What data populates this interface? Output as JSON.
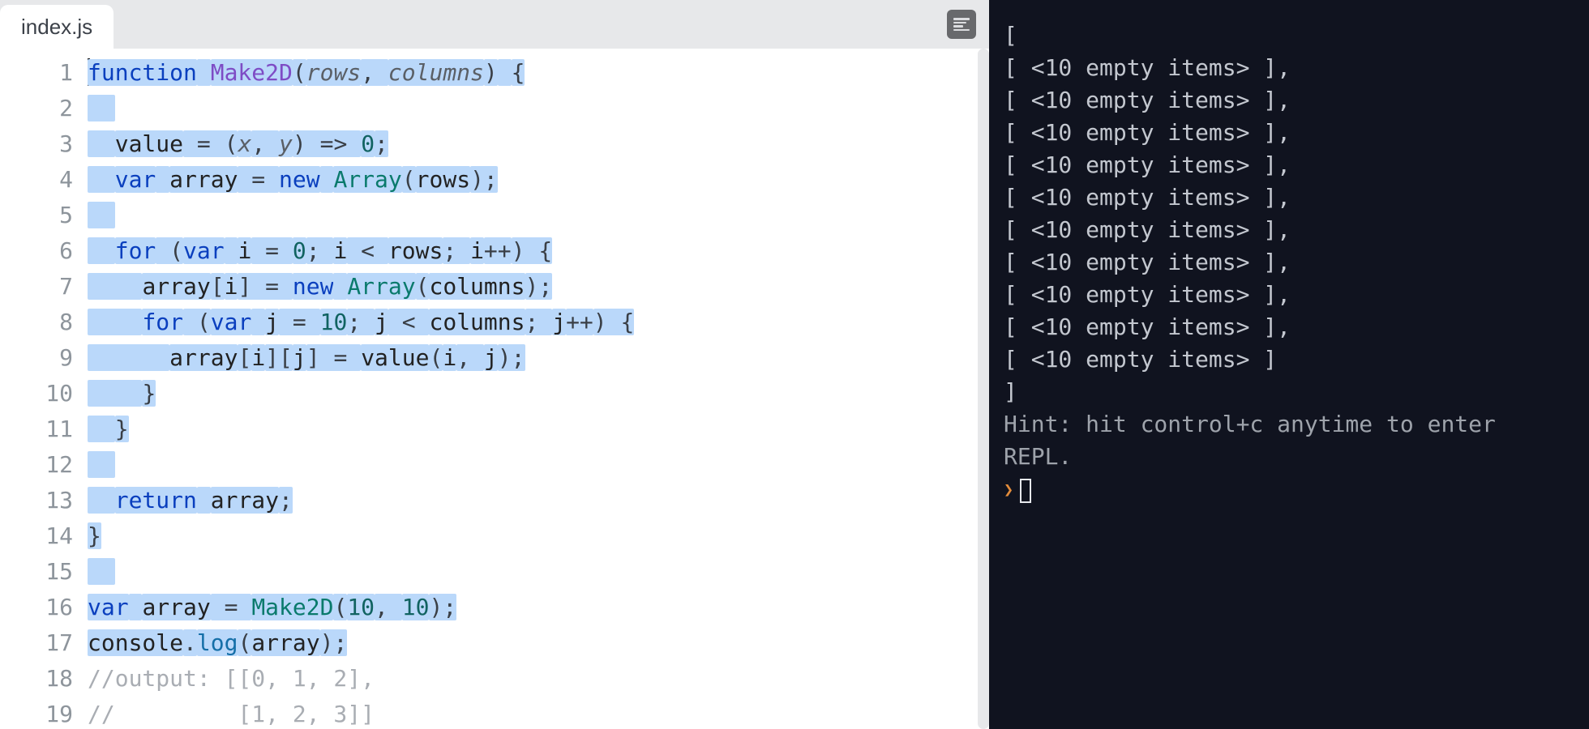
{
  "tabs": {
    "active": "index.js"
  },
  "editor": {
    "line_count": 19,
    "code_tokens": [
      [
        {
          "t": "function",
          "c": "kw",
          "hl": true,
          "cursor_before": true
        },
        {
          "t": " ",
          "hl": true
        },
        {
          "t": "Make2D",
          "c": "fn",
          "hl": true
        },
        {
          "t": "(",
          "c": "punct",
          "hl": true
        },
        {
          "t": "rows",
          "c": "param",
          "hl": true
        },
        {
          "t": ", ",
          "c": "punct",
          "hl": true
        },
        {
          "t": "columns",
          "c": "param",
          "hl": true
        },
        {
          "t": ")",
          "c": "punct",
          "hl": true
        },
        {
          "t": " ",
          "hl": true
        },
        {
          "t": "{",
          "c": "punct",
          "hl": true
        }
      ],
      [
        {
          "t": "  ",
          "hl": true
        }
      ],
      [
        {
          "t": "  ",
          "hl": true
        },
        {
          "t": "value",
          "c": "id",
          "hl": true
        },
        {
          "t": " = (",
          "c": "op",
          "hl": true
        },
        {
          "t": "x",
          "c": "param",
          "hl": true
        },
        {
          "t": ", ",
          "c": "punct",
          "hl": true
        },
        {
          "t": "y",
          "c": "param",
          "hl": true
        },
        {
          "t": ") => ",
          "c": "op",
          "hl": true
        },
        {
          "t": "0",
          "c": "nm",
          "hl": true
        },
        {
          "t": ";",
          "c": "punct",
          "hl": true
        }
      ],
      [
        {
          "t": "  ",
          "hl": true
        },
        {
          "t": "var",
          "c": "kw",
          "hl": true
        },
        {
          "t": " ",
          "hl": true
        },
        {
          "t": "array",
          "c": "id",
          "hl": true
        },
        {
          "t": " = ",
          "c": "op",
          "hl": true
        },
        {
          "t": "new",
          "c": "kw",
          "hl": true
        },
        {
          "t": " ",
          "hl": true
        },
        {
          "t": "Array",
          "c": "cls",
          "hl": true
        },
        {
          "t": "(",
          "c": "punct",
          "hl": true
        },
        {
          "t": "rows",
          "c": "id",
          "hl": true
        },
        {
          "t": ");",
          "c": "punct",
          "hl": true
        }
      ],
      [
        {
          "t": "  ",
          "hl": true
        }
      ],
      [
        {
          "t": "  ",
          "hl": true
        },
        {
          "t": "for",
          "c": "kw",
          "hl": true
        },
        {
          "t": " (",
          "c": "punct",
          "hl": true
        },
        {
          "t": "var",
          "c": "kw",
          "hl": true
        },
        {
          "t": " ",
          "hl": true
        },
        {
          "t": "i",
          "c": "id",
          "hl": true
        },
        {
          "t": " = ",
          "c": "op",
          "hl": true
        },
        {
          "t": "0",
          "c": "nm",
          "hl": true
        },
        {
          "t": "; ",
          "c": "punct",
          "hl": true
        },
        {
          "t": "i",
          "c": "id",
          "hl": true
        },
        {
          "t": " < ",
          "c": "op",
          "hl": true
        },
        {
          "t": "rows",
          "c": "id",
          "hl": true
        },
        {
          "t": "; ",
          "c": "punct",
          "hl": true
        },
        {
          "t": "i",
          "c": "id",
          "hl": true
        },
        {
          "t": "++",
          "c": "op",
          "hl": true
        },
        {
          "t": ") {",
          "c": "punct",
          "hl": true
        }
      ],
      [
        {
          "t": "    ",
          "hl": true
        },
        {
          "t": "array",
          "c": "id",
          "hl": true
        },
        {
          "t": "[",
          "c": "punct",
          "hl": true
        },
        {
          "t": "i",
          "c": "id",
          "hl": true
        },
        {
          "t": "] = ",
          "c": "op",
          "hl": true
        },
        {
          "t": "new",
          "c": "kw",
          "hl": true
        },
        {
          "t": " ",
          "hl": true
        },
        {
          "t": "Array",
          "c": "cls",
          "hl": true
        },
        {
          "t": "(",
          "c": "punct",
          "hl": true
        },
        {
          "t": "columns",
          "c": "id",
          "hl": true
        },
        {
          "t": ");",
          "c": "punct",
          "hl": true
        }
      ],
      [
        {
          "t": "    ",
          "hl": true
        },
        {
          "t": "for",
          "c": "kw",
          "hl": true
        },
        {
          "t": " (",
          "c": "punct",
          "hl": true
        },
        {
          "t": "var",
          "c": "kw",
          "hl": true
        },
        {
          "t": " ",
          "hl": true
        },
        {
          "t": "j",
          "c": "id",
          "hl": true
        },
        {
          "t": " = ",
          "c": "op",
          "hl": true
        },
        {
          "t": "10",
          "c": "nm",
          "hl": true
        },
        {
          "t": "; ",
          "c": "punct",
          "hl": true
        },
        {
          "t": "j",
          "c": "id",
          "hl": true
        },
        {
          "t": " < ",
          "c": "op",
          "hl": true
        },
        {
          "t": "columns",
          "c": "id",
          "hl": true
        },
        {
          "t": "; ",
          "c": "punct",
          "hl": true
        },
        {
          "t": "j",
          "c": "id",
          "hl": true
        },
        {
          "t": "++",
          "c": "op",
          "hl": true
        },
        {
          "t": ") {",
          "c": "punct",
          "hl": true
        }
      ],
      [
        {
          "t": "      ",
          "hl": true
        },
        {
          "t": "array",
          "c": "id",
          "hl": true
        },
        {
          "t": "[",
          "c": "punct",
          "hl": true
        },
        {
          "t": "i",
          "c": "id",
          "hl": true
        },
        {
          "t": "][",
          "c": "punct",
          "hl": true
        },
        {
          "t": "j",
          "c": "id",
          "hl": true
        },
        {
          "t": "] = ",
          "c": "op",
          "hl": true
        },
        {
          "t": "value",
          "c": "id",
          "hl": true
        },
        {
          "t": "(",
          "c": "punct",
          "hl": true
        },
        {
          "t": "i",
          "c": "id",
          "hl": true
        },
        {
          "t": ", ",
          "c": "punct",
          "hl": true
        },
        {
          "t": "j",
          "c": "id",
          "hl": true
        },
        {
          "t": ");",
          "c": "punct",
          "hl": true
        }
      ],
      [
        {
          "t": "    ",
          "hl": true
        },
        {
          "t": "}",
          "c": "punct",
          "hl": true
        }
      ],
      [
        {
          "t": "  ",
          "hl": true
        },
        {
          "t": "}",
          "c": "punct",
          "hl": true
        }
      ],
      [
        {
          "t": "  ",
          "hl": true
        }
      ],
      [
        {
          "t": "  ",
          "hl": true
        },
        {
          "t": "return",
          "c": "kw",
          "hl": true
        },
        {
          "t": " ",
          "hl": true
        },
        {
          "t": "array",
          "c": "id",
          "hl": true
        },
        {
          "t": ";",
          "c": "punct",
          "hl": true
        }
      ],
      [
        {
          "t": "}",
          "c": "punct",
          "hl": true
        }
      ],
      [
        {
          "t": "  ",
          "hl": true
        }
      ],
      [
        {
          "t": "var",
          "c": "kw",
          "hl": true
        },
        {
          "t": " ",
          "hl": true
        },
        {
          "t": "array",
          "c": "id",
          "hl": true
        },
        {
          "t": " = ",
          "c": "op",
          "hl": true
        },
        {
          "t": "Make2D",
          "c": "cls",
          "hl": true
        },
        {
          "t": "(",
          "c": "punct",
          "hl": true
        },
        {
          "t": "10",
          "c": "nm",
          "hl": true
        },
        {
          "t": ", ",
          "c": "punct",
          "hl": true
        },
        {
          "t": "10",
          "c": "nm",
          "hl": true
        },
        {
          "t": ");",
          "c": "punct",
          "hl": true
        }
      ],
      [
        {
          "t": "console",
          "c": "id",
          "hl": true
        },
        {
          "t": ".",
          "c": "punct",
          "hl": true
        },
        {
          "t": "log",
          "c": "method",
          "hl": true
        },
        {
          "t": "(",
          "c": "punct",
          "hl": true
        },
        {
          "t": "array",
          "c": "id",
          "hl": true
        },
        {
          "t": ");",
          "c": "punct",
          "hl": true
        }
      ],
      [
        {
          "t": "//output: [[0, 1, 2], ",
          "c": "cmt"
        }
      ],
      [
        {
          "t": "//         [1, 2, 3]]",
          "c": "cmt"
        }
      ]
    ]
  },
  "terminal": {
    "lines": [
      "[",
      "  [ <10 empty items> ],",
      "  [ <10 empty items> ],",
      "  [ <10 empty items> ],",
      "  [ <10 empty items> ],",
      "  [ <10 empty items> ],",
      "  [ <10 empty items> ],",
      "  [ <10 empty items> ],",
      "  [ <10 empty items> ],",
      "  [ <10 empty items> ],",
      "  [ <10 empty items> ]",
      "]"
    ],
    "hint": "Hint: hit control+c anytime to enter REPL.",
    "prompt": "❯"
  }
}
